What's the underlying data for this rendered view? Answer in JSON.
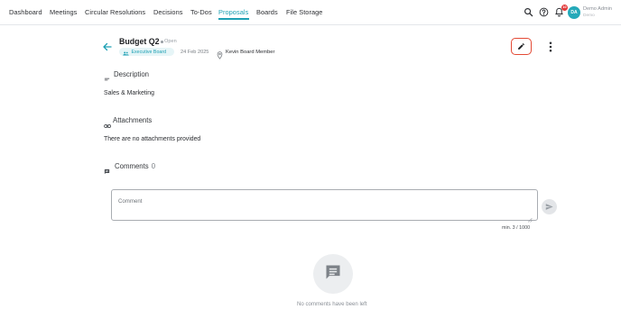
{
  "nav": {
    "items": [
      {
        "label": "Dashboard",
        "active": false
      },
      {
        "label": "Meetings",
        "active": false
      },
      {
        "label": "Circular Resolutions",
        "active": false
      },
      {
        "label": "Decisions",
        "active": false
      },
      {
        "label": "To-Dos",
        "active": false
      },
      {
        "label": "Proposals",
        "active": true
      },
      {
        "label": "Boards",
        "active": false
      },
      {
        "label": "File Storage",
        "active": false
      }
    ],
    "notification_count": "10",
    "user": {
      "initials": "DA",
      "name": "Demo Admin",
      "org": "Demo"
    }
  },
  "proposal": {
    "title": "Budget Q2",
    "status": "Open",
    "board": "Executive Board",
    "date": "24 Feb 2025",
    "member": "Kevin Board Member"
  },
  "description": {
    "title": "Description",
    "text": "Sales & Marketing"
  },
  "attachments": {
    "title": "Attachments",
    "empty_text": "There are no attachments provided"
  },
  "comments": {
    "title": "Comments",
    "count": "0",
    "placeholder": "Comment",
    "counter": "min. 3 / 1000",
    "empty_text": "No comments have been left"
  },
  "icons": {
    "search": "search-icon",
    "help": "help-icon",
    "bell": "bell-icon",
    "back": "arrow-back-icon",
    "group": "group-icon",
    "location": "location-pin-icon",
    "edit": "pencil-icon",
    "more": "more-vertical-icon",
    "description": "short-text-icon",
    "attachment": "link-icon",
    "comments": "comment-icon",
    "send": "send-icon"
  },
  "colors": {
    "accent": "#1ea0b4",
    "edit_border": "#e34a35",
    "badge": "#e23b3b"
  }
}
